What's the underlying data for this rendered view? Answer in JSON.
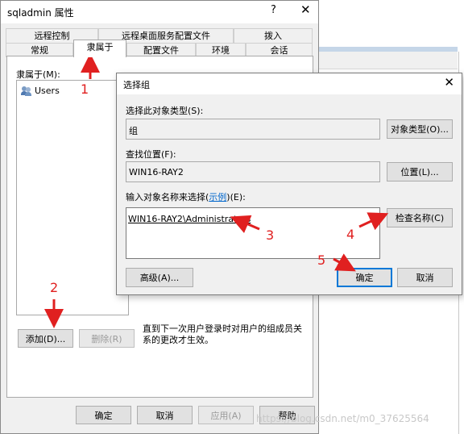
{
  "main_window": {
    "title": "sqladmin 属性",
    "help_icon": "?",
    "close_icon": "✕",
    "tabs_row1": [
      "远程控制",
      "远程桌面服务配置文件",
      "拨入"
    ],
    "tabs_row2": [
      "常规",
      "隶属于",
      "配置文件",
      "环境",
      "会话"
    ],
    "active_tab": "隶属于",
    "member_of_label": "隶属于(M):",
    "members": [
      {
        "icon": "group-icon",
        "label": "Users"
      }
    ],
    "add_button": "添加(D)...",
    "remove_button": "删除(R)",
    "note": "直到下一次用户登录时对用户的组成员关系的更改才生效。",
    "note_line1": "直到下一次用户登录时对用户的组成员关",
    "note_line2": "系的更改才生效。",
    "ok_button": "确定",
    "cancel_button": "取消",
    "apply_button": "应用(A)",
    "help_button": "帮助"
  },
  "dialog": {
    "title": "选择组",
    "close_icon": "✕",
    "object_type_label": "选择此对象类型(S):",
    "object_type_value": "组",
    "object_type_button": "对象类型(O)...",
    "location_label": "查找位置(F):",
    "location_value": "WIN16-RAY2",
    "location_button": "位置(L)...",
    "names_label_prefix": "输入对象名称来选择(",
    "names_label_link": "示例",
    "names_label_suffix": ")(E):",
    "names_value": "WIN16-RAY2\\Administrators",
    "check_names_button": "检查名称(C)",
    "advanced_button": "高级(A)...",
    "ok_button": "确定",
    "cancel_button": "取消"
  },
  "annotations": [
    "1",
    "2",
    "3",
    "4",
    "5"
  ],
  "annotation_color": "#e02020",
  "accent_color": "#0078d7",
  "watermark": "https://blog.csdn.net/m0_37625564"
}
